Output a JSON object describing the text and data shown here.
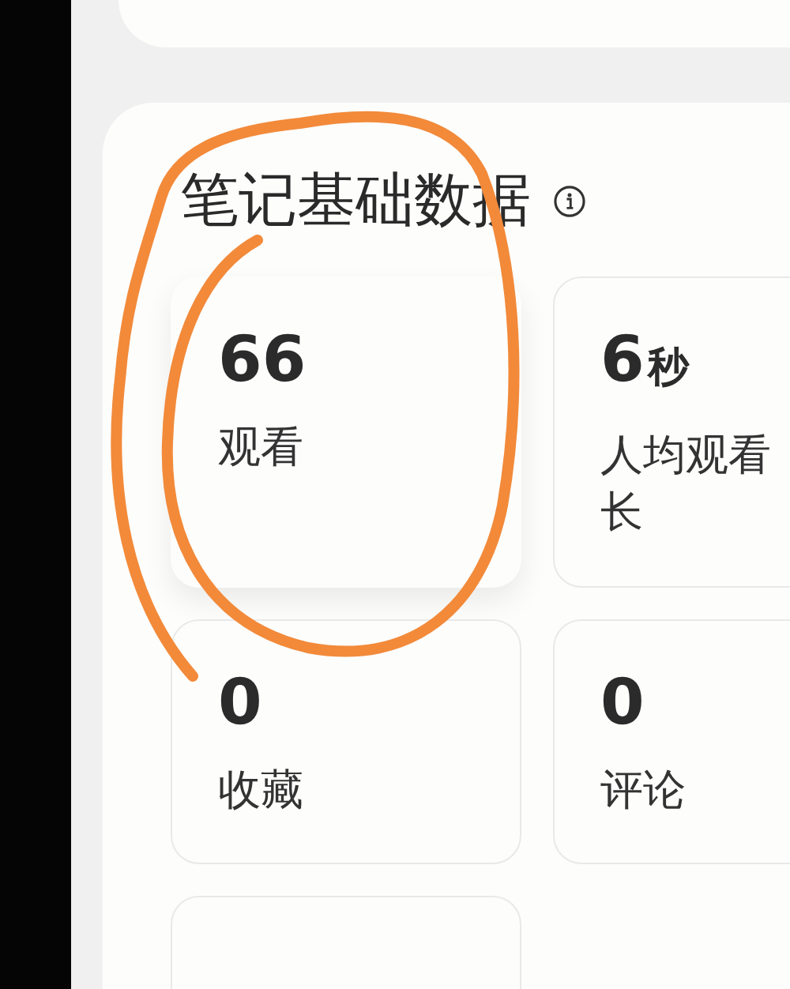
{
  "section": {
    "title": "笔记基础数据",
    "info": true
  },
  "stats": [
    {
      "value": "66",
      "label": [
        "观看"
      ],
      "selected": true
    },
    {
      "value": "6",
      "unit": "秒",
      "label": [
        "人均观看",
        "长"
      ],
      "selected": false
    },
    {
      "value": "0",
      "label": [
        "收藏"
      ],
      "selected": false
    },
    {
      "value": "0",
      "label": [
        "评论"
      ],
      "selected": false
    },
    {
      "selected": false
    }
  ],
  "annotation": {
    "kind": "loop"
  }
}
